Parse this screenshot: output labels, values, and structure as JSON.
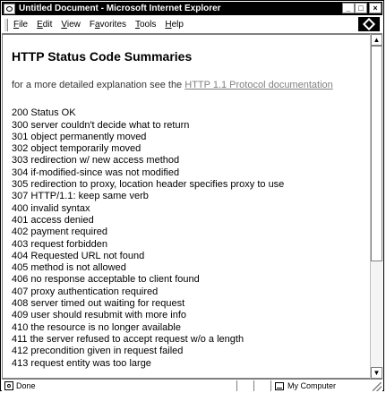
{
  "window": {
    "title": "Untitled Document - Microsoft Internet Explorer",
    "minimize": "_",
    "maximize": "□",
    "close": "×"
  },
  "menubar": {
    "items": [
      {
        "underline": "F",
        "rest": "ile"
      },
      {
        "underline": "E",
        "rest": "dit"
      },
      {
        "underline": "V",
        "rest": "iew"
      },
      {
        "pre": "F",
        "underline": "a",
        "rest": "vorites"
      },
      {
        "underline": "T",
        "rest": "ools"
      },
      {
        "underline": "H",
        "rest": "elp"
      }
    ]
  },
  "page": {
    "heading": "HTTP Status Code Summaries",
    "intro_text": "for a more detailed explanation see the ",
    "intro_link": "HTTP 1.1 Protocol documentation",
    "codes": [
      "200 Status OK",
      "300 server couldn't decide what to return",
      "301 object permanently moved",
      "302 object temporarily moved",
      "303 redirection w/ new access method",
      "304 if-modified-since was not modified",
      "305 redirection to proxy, location header specifies proxy to use",
      "307 HTTP/1.1: keep same verb",
      "400 invalid syntax",
      "401 access denied",
      "402 payment required",
      "403 request forbidden",
      "404 Requested URL not found",
      "405 method is not allowed",
      "406 no response acceptable to client found",
      "407 proxy authentication required",
      "408 server timed out waiting for request",
      "409 user should resubmit with more info",
      "410 the resource is no longer available",
      "411 the server refused to accept request w/o a length",
      "412 precondition given in request failed",
      "413 request entity was too large"
    ]
  },
  "scrollbar": {
    "up": "▲",
    "down": "▼",
    "thumb_fraction": 0.67
  },
  "statusbar": {
    "status": "Done",
    "zone": "My Computer"
  },
  "colors": {
    "titlebar": "#000000",
    "link": "#808080",
    "border": "#808080"
  }
}
